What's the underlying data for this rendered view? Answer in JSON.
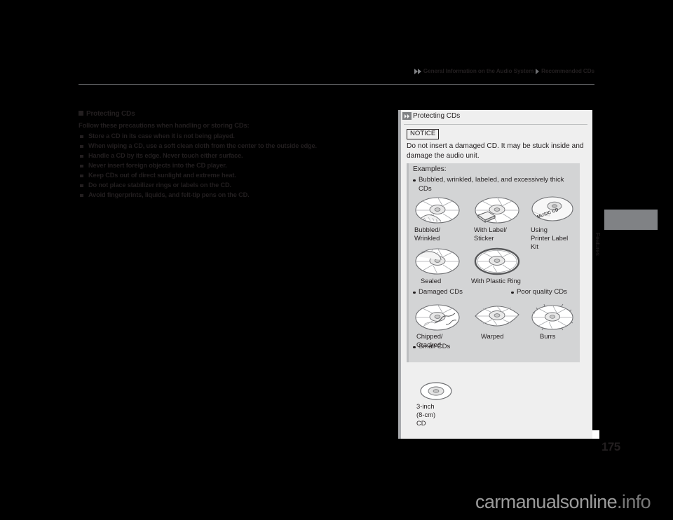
{
  "header": {
    "breadcrumb_parent": "General Information on the Audio System",
    "breadcrumb_current": "Recommended CDs"
  },
  "left": {
    "section_heading": "Protecting CDs",
    "lead": "Follow these precautions when handling or storing CDs:",
    "bullets": [
      "Store a CD in its case when it is not being played.",
      "When wiping a CD, use a soft clean cloth from the center to the outside edge.",
      "Handle a CD by its edge. Never touch either surface.",
      "Never insert foreign objects into the CD player.",
      "Keep CDs out of direct sunlight and extreme heat.",
      "Do not place stabilizer rings or labels on the CD.",
      "Avoid fingerprints, liquids, and felt-tip pens on the CD."
    ]
  },
  "panel": {
    "title": "Protecting CDs",
    "notice_label": "NOTICE",
    "notice_text": "Do not insert a damaged CD. It may be stuck inside and damage the audio unit.",
    "examples_title": "Examples:",
    "groups": [
      {
        "bullet": "Bubbled, wrinkled, labeled, and excessively thick CDs"
      },
      {
        "bullet": "Damaged CDs"
      },
      {
        "bullet": "Poor quality CDs"
      },
      {
        "bullet": "Small CDs"
      }
    ],
    "captions": {
      "bubbled": "Bubbled/\nWrinkled",
      "label_sticker": "With Label/\nSticker",
      "printer_kit": "Using\nPrinter Label\nKit",
      "sealed": "Sealed",
      "plastic_ring": "With Plastic Ring",
      "chipped": "Chipped/\nCracked",
      "warped": "Warped",
      "burrs": "Burrs",
      "small_cd": "3-inch\n(8-cm)\nCD"
    },
    "disc_mark_text": "MUSIC CD"
  },
  "side": {
    "tab_label": "Features"
  },
  "footer": {
    "page_number": "175",
    "watermark_main": "carmanualsonline",
    "watermark_tld": ".info"
  }
}
